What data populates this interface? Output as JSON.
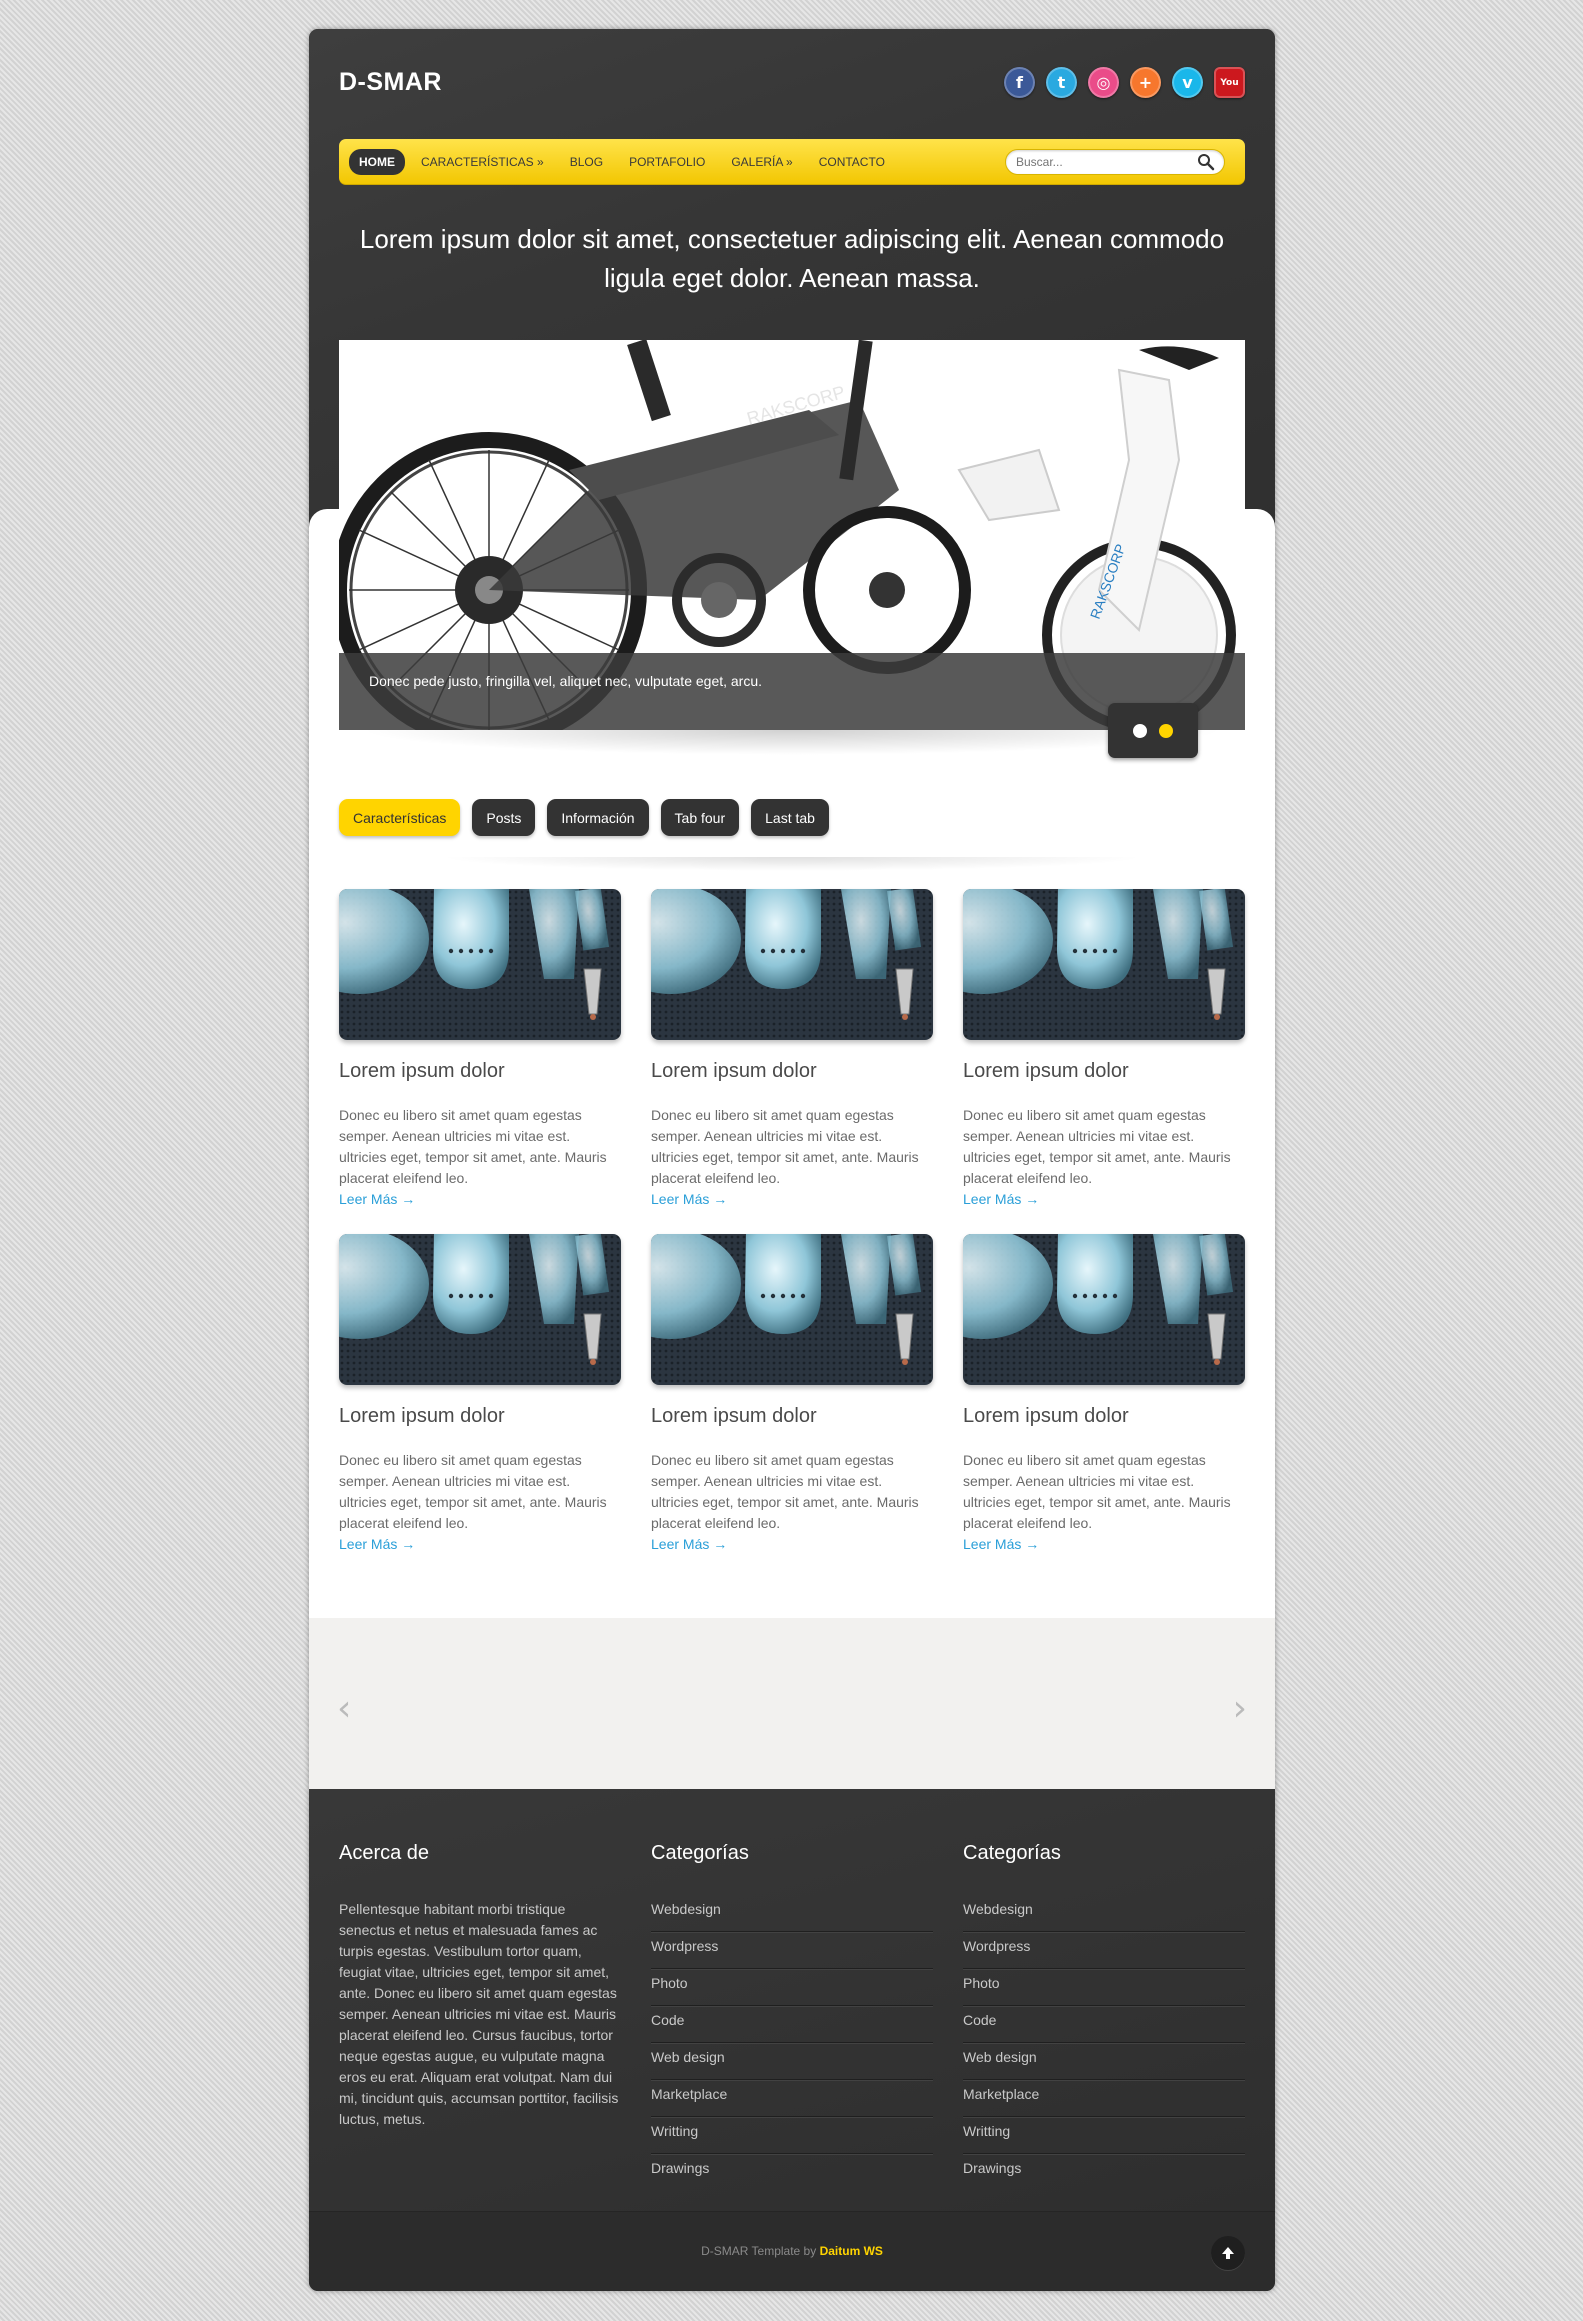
{
  "site": {
    "logo": "D-SMAR"
  },
  "social": [
    {
      "name": "facebook",
      "glyph": "f",
      "color": "#3b5998"
    },
    {
      "name": "twitter",
      "glyph": "t",
      "color": "#2aa9e0"
    },
    {
      "name": "dribbble",
      "glyph": "◎",
      "color": "#ea4c89"
    },
    {
      "name": "google-plus",
      "glyph": "+",
      "color": "#f7772d"
    },
    {
      "name": "vimeo",
      "glyph": "v",
      "color": "#1ab7ea"
    },
    {
      "name": "youtube",
      "glyph": "You",
      "color": "#cc181e"
    }
  ],
  "nav": {
    "items": [
      "Home",
      "Características »",
      "Blog",
      "Portafolio",
      "Galería »",
      "Contacto"
    ],
    "search_placeholder": "Buscar..."
  },
  "tagline": "Lorem ipsum dolor sit amet, consectetuer adipiscing elit. Aenean commodo ligula eget dolor. Aenean massa.",
  "slider": {
    "caption": "Donec pede justo, fringilla vel, aliquet nec, vulputate eget, arcu.",
    "brand_text": "RAKSCORP",
    "dot_colors": [
      "#ffffff",
      "#ffd400"
    ]
  },
  "tabs": [
    "Características",
    "Posts",
    "Información",
    "Tab four",
    "Last tab"
  ],
  "cards": [
    {
      "title": "Lorem ipsum dolor",
      "text": "Donec eu libero sit amet quam egestas semper. Aenean ultricies mi vitae est. ultricies eget, tempor sit amet, ante. Mauris placerat eleifend leo.",
      "link": "Leer Más →"
    },
    {
      "title": "Lorem ipsum dolor",
      "text": "Donec eu libero sit amet quam egestas semper. Aenean ultricies mi vitae est. ultricies eget, tempor sit amet, ante. Mauris placerat eleifend leo.",
      "link": "Leer Más →"
    },
    {
      "title": "Lorem ipsum dolor",
      "text": "Donec eu libero sit amet quam egestas semper. Aenean ultricies mi vitae est. ultricies eget, tempor sit amet, ante. Mauris placerat eleifend leo.",
      "link": "Leer Más →"
    },
    {
      "title": "Lorem ipsum dolor",
      "text": "Donec eu libero sit amet quam egestas semper. Aenean ultricies mi vitae est. ultricies eget, tempor sit amet, ante. Mauris placerat eleifend leo.",
      "link": "Leer Más →"
    },
    {
      "title": "Lorem ipsum dolor",
      "text": "Donec eu libero sit amet quam egestas semper. Aenean ultricies mi vitae est. ultricies eget, tempor sit amet, ante. Mauris placerat eleifend leo.",
      "link": "Leer Más →"
    },
    {
      "title": "Lorem ipsum dolor",
      "text": "Donec eu libero sit amet quam egestas semper. Aenean ultricies mi vitae est. ultricies eget, tempor sit amet, ante. Mauris placerat eleifend leo.",
      "link": "Leer Más →"
    }
  ],
  "carousel": {
    "prev": "‹",
    "next": "›"
  },
  "footer": {
    "about": {
      "title": "Acerca de",
      "text": "Pellentesque habitant morbi tristique senectus et netus et malesuada fames ac turpis egestas. Vestibulum tortor quam, feugiat vitae, ultricies eget, tempor sit amet, ante. Donec eu libero sit amet quam egestas semper. Aenean ultricies mi vitae est. Mauris placerat eleifend leo. Cursus faucibus, tortor neque egestas augue, eu vulputate magna eros eu erat. Aliquam erat volutpat. Nam dui mi, tincidunt quis, accumsan porttitor, facilisis luctus, metus."
    },
    "categories_1": {
      "title": "Categorías",
      "items": [
        "Webdesign",
        "Wordpress",
        "Photo",
        "Code",
        "Web design",
        "Marketplace",
        "Writting",
        "Drawings"
      ]
    },
    "categories_2": {
      "title": "Categorías",
      "items": [
        "Webdesign",
        "Wordpress",
        "Photo",
        "Code",
        "Web design",
        "Marketplace",
        "Writting",
        "Drawings"
      ]
    },
    "credit_prefix": "D-SMAR Template by",
    "credit_brand": "Daitum WS"
  },
  "colors": {
    "accent": "#ffd400",
    "dark": "#333333",
    "link": "#2a9fd8"
  }
}
